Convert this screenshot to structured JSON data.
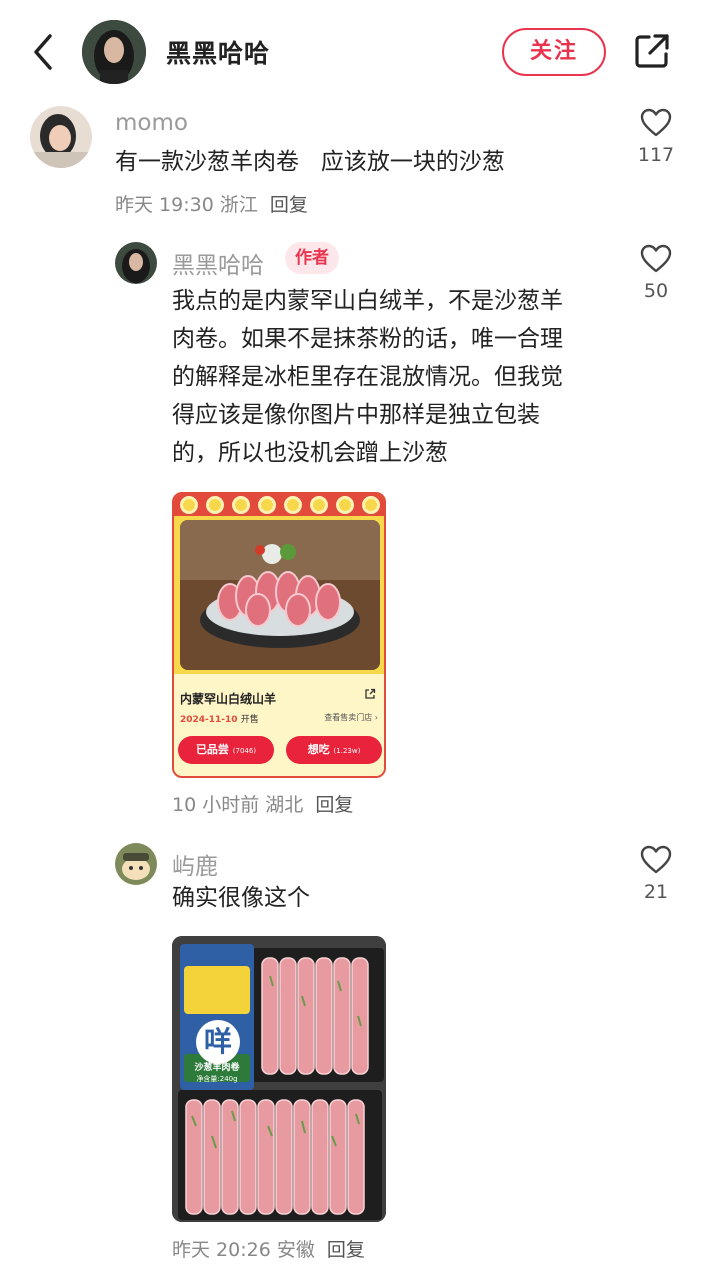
{
  "header": {
    "user_name": "黑黑哈哈",
    "follow_label": "关注"
  },
  "comments": [
    {
      "user": "momo",
      "text": "有一款沙葱羊肉卷   应该放一块的沙葱",
      "time": "昨天 19:30",
      "location": "浙江",
      "reply_label": "回复",
      "likes": "117"
    },
    {
      "user": "黑黑哈哈",
      "tag": "作者",
      "text_lines": [
        "我点的是内蒙罕山白绒羊，不是沙葱羊",
        "肉卷。如果不是抹茶粉的话，唯一合理",
        "的解释是冰柜里存在混放情况。但我觉",
        "得应该是像你图片中那样是独立包装",
        "的，所以也没机会蹭上沙葱"
      ],
      "time": "10 小时前",
      "location": "湖北",
      "reply_label": "回复",
      "likes": "50",
      "card": {
        "title": "内蒙罕山白绒山羊",
        "date": "2024-11-10",
        "date_suffix": "开售",
        "store_link": "查看售卖门店 ›",
        "btn_left": "已品尝",
        "btn_left_count": "(7046)",
        "btn_right": "想吃",
        "btn_right_count": "(1.23w)"
      }
    },
    {
      "user": "屿鹿",
      "text": "确实很像这个",
      "time": "昨天 20:26",
      "location": "安徽",
      "reply_label": "回复",
      "likes": "21",
      "photo": {
        "logo": "咩",
        "product_name": "沙葱羊肉卷",
        "weight": "净含量:240g"
      }
    }
  ],
  "colors": {
    "accent": "#e8344e",
    "card_yellow": "#f7d84a",
    "card_red": "#e24a3b"
  }
}
